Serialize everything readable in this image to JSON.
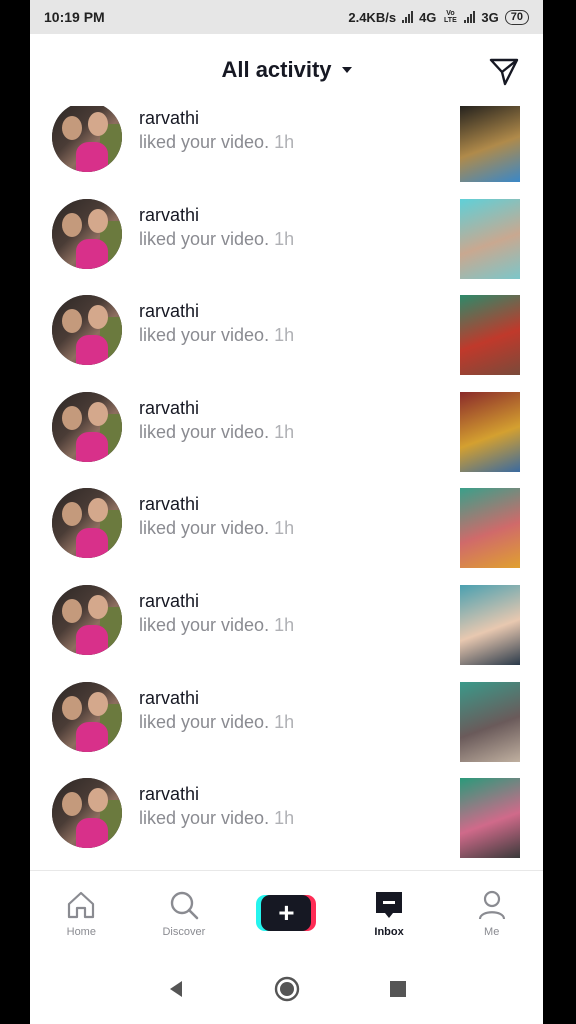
{
  "status_bar": {
    "time": "10:19 PM",
    "speed": "2.4KB/s",
    "network1": "4G",
    "volte": "Vo LTE",
    "network2": "3G",
    "battery": "70"
  },
  "header": {
    "title": "All activity",
    "send_icon": "paper-plane-icon"
  },
  "activity": [
    {
      "username": "rarvathi",
      "message": "liked your video.",
      "time": "1h",
      "thumb_colors": [
        "#1a1a1a",
        "#b08a4a",
        "#3a88c8"
      ]
    },
    {
      "username": "rarvathi",
      "message": "liked your video.",
      "time": "1h",
      "thumb_colors": [
        "#5fd0d8",
        "#c9a890",
        "#7cc6c9"
      ]
    },
    {
      "username": "rarvathi",
      "message": "liked your video.",
      "time": "1h",
      "thumb_colors": [
        "#2d8a6a",
        "#c0392b",
        "#7a4a3a"
      ]
    },
    {
      "username": "rarvathi",
      "message": "liked your video.",
      "time": "1h",
      "thumb_colors": [
        "#8a2a2a",
        "#d4a030",
        "#3a6aa0"
      ]
    },
    {
      "username": "rarvathi",
      "message": "liked your video.",
      "time": "1h",
      "thumb_colors": [
        "#3aa08a",
        "#d06a6a",
        "#e0a030"
      ]
    },
    {
      "username": "rarvathi",
      "message": "liked your video.",
      "time": "1h",
      "thumb_colors": [
        "#4aa0b0",
        "#e8c8b0",
        "#2a3a4a"
      ]
    },
    {
      "username": "rarvathi",
      "message": "liked your video.",
      "time": "1h",
      "thumb_colors": [
        "#3a9a8a",
        "#6a5a5a",
        "#c0b0a0"
      ]
    },
    {
      "username": "rarvathi",
      "message": "liked your video.",
      "time": "1h",
      "thumb_colors": [
        "#2a9a7a",
        "#d06a8a",
        "#3a3a3a"
      ]
    },
    {
      "username": "",
      "message": "",
      "time": "",
      "thumb_colors": [
        "#1a1a1a",
        "#c03030",
        "#1a1a1a"
      ]
    }
  ],
  "bottom_nav": {
    "home": "Home",
    "discover": "Discover",
    "inbox": "Inbox",
    "me": "Me"
  },
  "colors": {
    "accent_cyan": "#25f4ee",
    "accent_pink": "#fe2c55",
    "text_primary": "#161823",
    "text_secondary": "#8a8b91"
  }
}
